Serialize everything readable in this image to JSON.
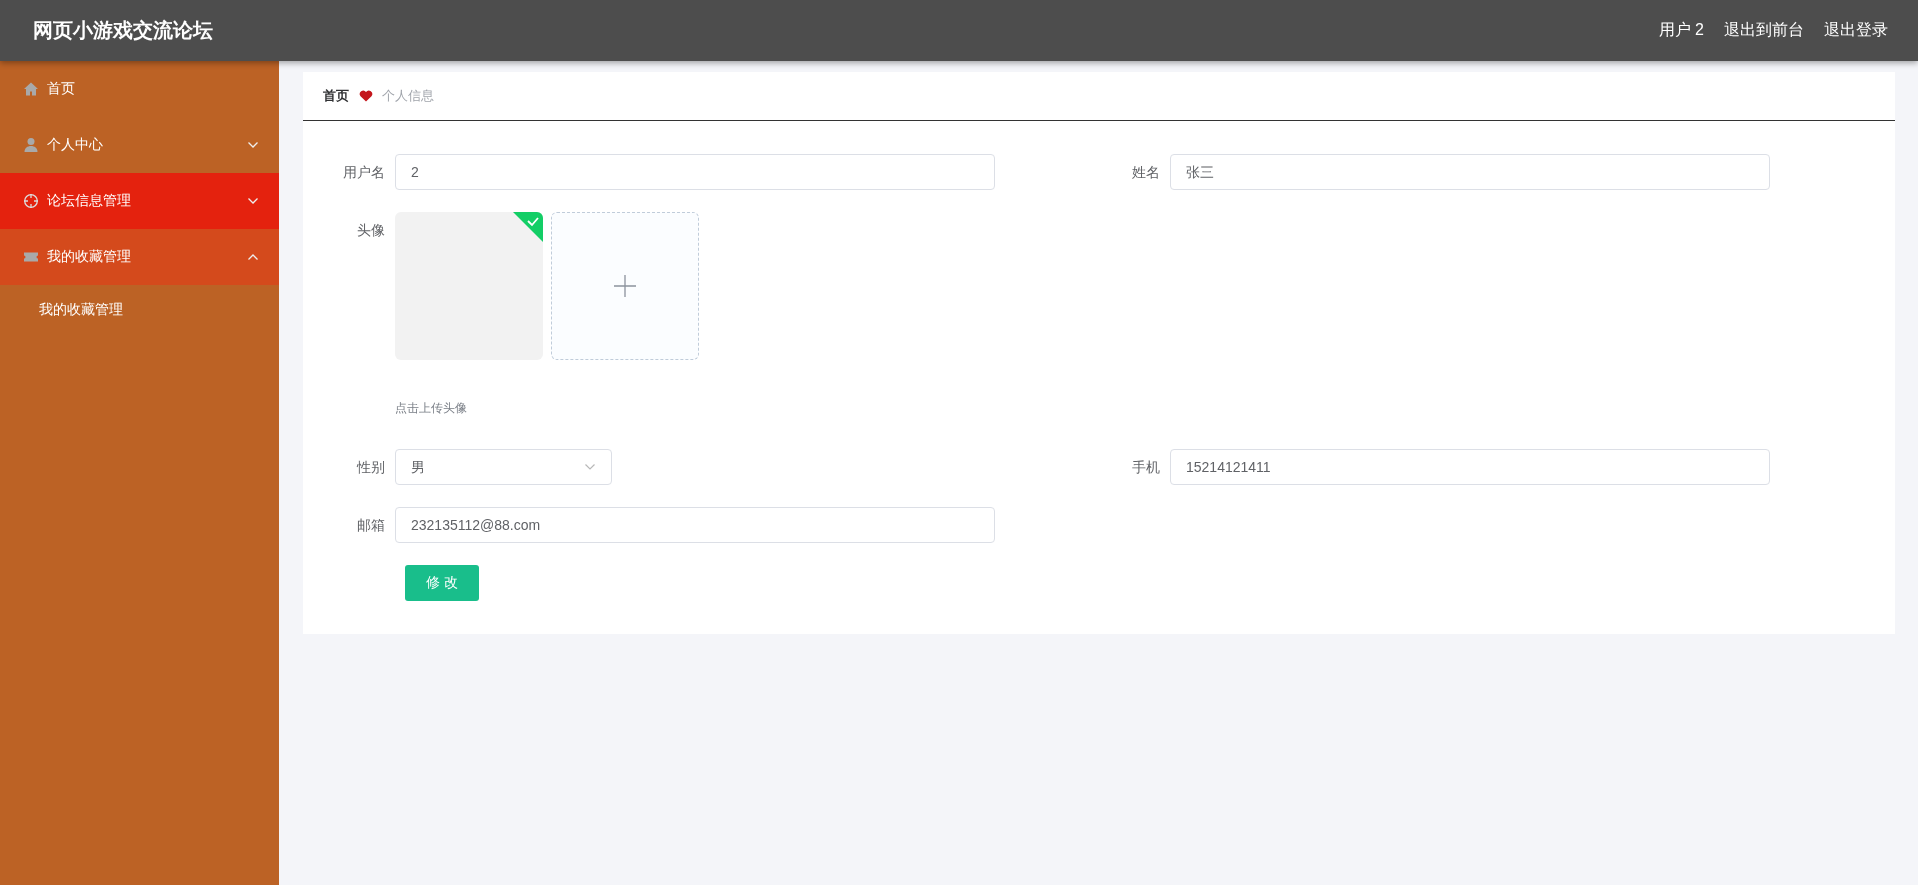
{
  "header": {
    "title": "网页小游戏交流论坛",
    "links": [
      {
        "label": "用户 2"
      },
      {
        "label": "退出到前台"
      },
      {
        "label": "退出登录"
      }
    ]
  },
  "sidebar": {
    "items": [
      {
        "label": "首页",
        "kind": "link",
        "selected": false
      },
      {
        "label": "个人中心",
        "kind": "group",
        "selected": false,
        "expanded": false
      },
      {
        "label": "论坛信息管理",
        "kind": "group",
        "selected": true,
        "expanded": false
      },
      {
        "label": "我的收藏管理",
        "kind": "group",
        "selected": false,
        "expanded": true,
        "children": [
          {
            "label": "我的收藏管理"
          }
        ]
      }
    ]
  },
  "breadcrumb": {
    "home": "首页",
    "current": "个人信息"
  },
  "form": {
    "rows": [
      [
        {
          "kind": "text",
          "label": "用户名",
          "value": "2"
        },
        {
          "kind": "text",
          "label": "姓名",
          "value": "张三"
        }
      ],
      [
        {
          "kind": "avatar",
          "label": "头像",
          "uploaded": true,
          "hint": "点击上传头像"
        }
      ],
      [
        {
          "kind": "select",
          "label": "性别",
          "value": "男"
        },
        {
          "kind": "text",
          "label": "手机",
          "value": "15214121411"
        }
      ],
      [
        {
          "kind": "text",
          "label": "邮箱",
          "value": "232135112@88.com"
        }
      ]
    ],
    "submit": "修 改"
  }
}
